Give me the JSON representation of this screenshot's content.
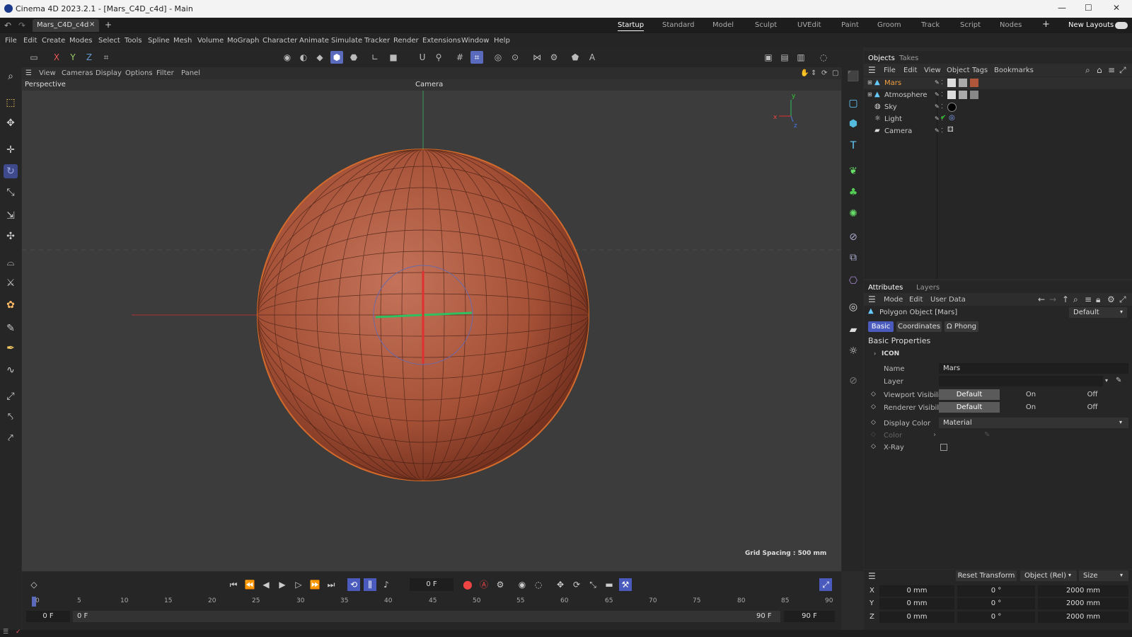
{
  "window": {
    "title": "Cinema 4D 2023.2.1 - [Mars_C4D_c4d] - Main"
  },
  "doc_tab": {
    "label": "Mars_C4D_c4d",
    "close": "×",
    "add": "+"
  },
  "layouts": {
    "items": [
      "Startup",
      "Standard",
      "Model",
      "Sculpt",
      "UVEdit",
      "Paint",
      "Groom",
      "Track",
      "Script",
      "Nodes"
    ],
    "add": "+",
    "new_layouts": "New Layouts"
  },
  "menu": [
    "File",
    "Edit",
    "Create",
    "Modes",
    "Select",
    "Tools",
    "Spline",
    "Mesh",
    "Volume",
    "MoGraph",
    "Character",
    "Animate",
    "Simulate",
    "Tracker",
    "Render",
    "Extensions",
    "Window",
    "Help"
  ],
  "axes": {
    "x": "X",
    "y": "Y",
    "z": "Z"
  },
  "viewport": {
    "menus": [
      "View",
      "Cameras",
      "Display",
      "Options",
      "Filter",
      "Panel"
    ],
    "view_name": "Perspective",
    "camera_label": "Camera",
    "grid_spacing": "Grid Spacing : 500 mm",
    "gizmo": {
      "x": "x",
      "y": "y",
      "z": "z"
    }
  },
  "objects_panel": {
    "tabs": [
      "Objects",
      "Takes"
    ],
    "menus": [
      "File",
      "Edit",
      "View",
      "Object",
      "Tags",
      "Bookmarks"
    ],
    "items": [
      {
        "name": "Mars",
        "selected": true
      },
      {
        "name": "Atmosphere"
      },
      {
        "name": "Sky"
      },
      {
        "name": "Light"
      },
      {
        "name": "Camera"
      }
    ]
  },
  "attributes_panel": {
    "tabs": [
      "Attributes",
      "Layers"
    ],
    "menus": [
      "Mode",
      "Edit",
      "User Data"
    ],
    "object_title": "Polygon Object [Mars]",
    "preset": "Default",
    "subtabs": [
      "Basic",
      "Coordinates",
      "Phong"
    ],
    "section": "Basic Properties",
    "icon_group": "ICON",
    "fields": {
      "name_label": "Name",
      "name_value": "Mars",
      "layer_label": "Layer",
      "viewport_label": "Viewport Visibility",
      "renderer_label": "Renderer Visibility",
      "display_color_label": "Display Color",
      "display_color_value": "Material",
      "color_label": "Color",
      "xray_label": "X-Ray"
    },
    "visibility_options": [
      "Default",
      "On",
      "Off"
    ]
  },
  "timeline": {
    "current_frame": "0 F",
    "start": "0 F",
    "start2": "0 F",
    "end": "90 F",
    "end2": "90 F",
    "ticks": [
      "0",
      "5",
      "10",
      "15",
      "20",
      "25",
      "30",
      "35",
      "40",
      "45",
      "50",
      "55",
      "60",
      "65",
      "70",
      "75",
      "80",
      "85",
      "90"
    ]
  },
  "coords": {
    "reset": "Reset Transform",
    "mode": "Object (Rel)",
    "size": "Size",
    "rows": [
      {
        "axis": "X",
        "pos": "0 mm",
        "rot": "0 °",
        "size": "2000 mm"
      },
      {
        "axis": "Y",
        "pos": "0 mm",
        "rot": "0 °",
        "size": "2000 mm"
      },
      {
        "axis": "Z",
        "pos": "0 mm",
        "rot": "0 °",
        "size": "2000 mm"
      }
    ]
  },
  "colors": {
    "accent": "#5a6bbd",
    "mars": "#b0563a",
    "selected_text": "#f0a040"
  }
}
